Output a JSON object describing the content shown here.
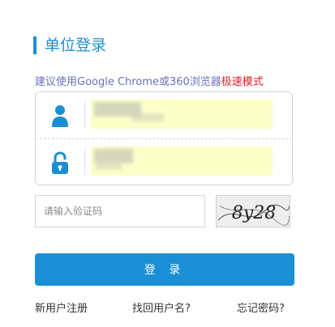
{
  "page": {
    "title": "单位登录",
    "browser_hint": {
      "prefix": "建议使用Google Chrome或360浏览器",
      "highlight": "极速模式"
    }
  },
  "form": {
    "username": {
      "icon": "user-icon",
      "value": ""
    },
    "password": {
      "icon": "lock-icon",
      "value": ""
    },
    "captcha": {
      "placeholder": "请输入验证码",
      "image_text": "8y28"
    },
    "login_label": "登 录"
  },
  "links": {
    "register": "新用户注册",
    "find_username": "找回用户名?",
    "forgot_password": "忘记密码?"
  },
  "colors": {
    "accent": "#1a8fd6",
    "hint_text": "#6b6ec2",
    "hint_highlight": "#e02020",
    "autofill_bg": "#fbffc8"
  }
}
